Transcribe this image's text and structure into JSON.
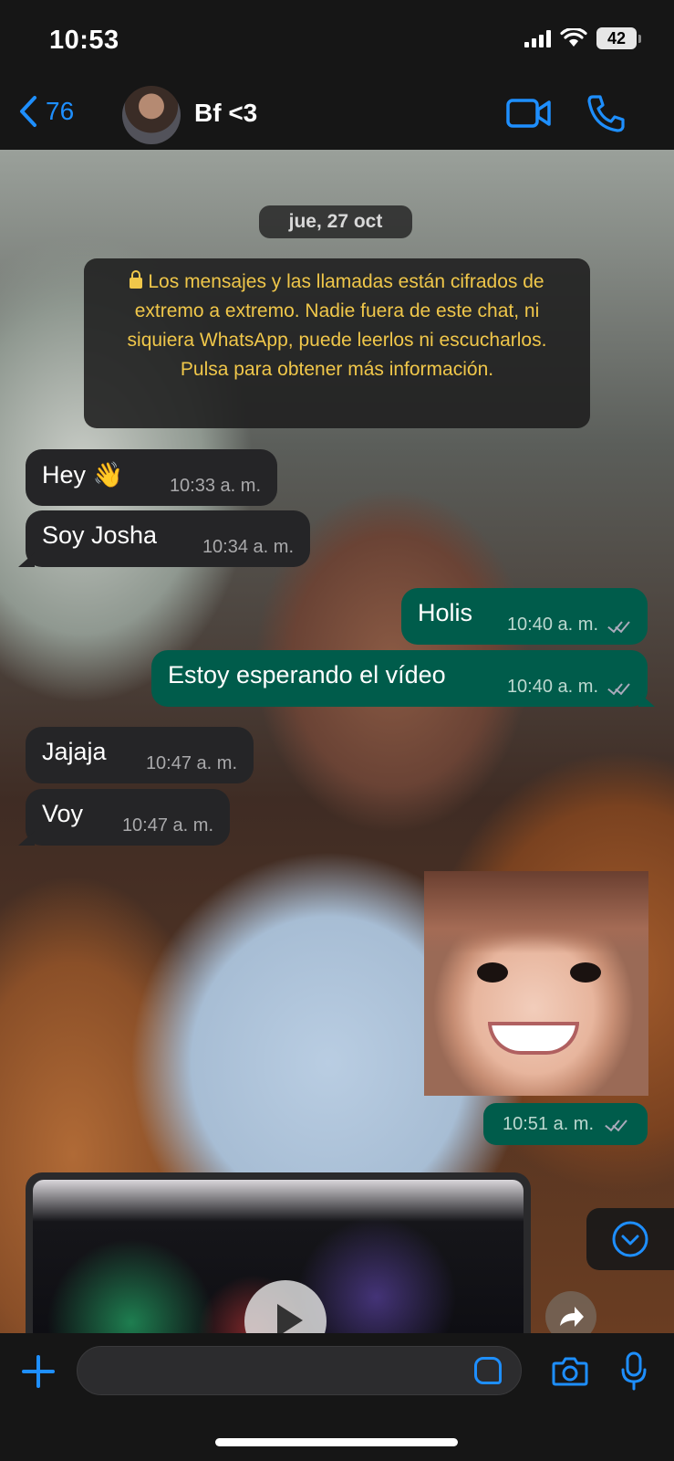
{
  "status_bar": {
    "time": "10:53",
    "battery": "42"
  },
  "header": {
    "back_count": "76",
    "contact_name": "Bf <3"
  },
  "chat": {
    "date_label": "jue, 27 oct",
    "encryption_notice": "Los mensajes y las llamadas están cifrados de extremo a extremo. Nadie fuera de este chat, ni siquiera WhatsApp, puede leerlos ni escucharlos. Pulsa para obtener más información.",
    "messages": [
      {
        "text": "Hey 👋",
        "time": "10:33 a. m.",
        "direction": "incoming"
      },
      {
        "text": "Soy Josha",
        "time": "10:34 a. m.",
        "direction": "incoming"
      },
      {
        "text": "Holis",
        "time": "10:40 a. m.",
        "direction": "outgoing",
        "status": "read"
      },
      {
        "text": "Estoy esperando el vídeo",
        "time": "10:40 a. m.",
        "direction": "outgoing",
        "status": "read"
      },
      {
        "text": "Jajaja",
        "time": "10:47 a. m.",
        "direction": "incoming"
      },
      {
        "text": "Voy",
        "time": "10:47 a. m.",
        "direction": "incoming"
      }
    ],
    "photo_message": {
      "time": "10:51 a. m.",
      "direction": "outgoing",
      "status": "read"
    },
    "video_message": {
      "direction": "incoming",
      "icon": "play-icon"
    }
  },
  "composer": {
    "placeholder": ""
  },
  "colors": {
    "accent": "#1e8fff",
    "outgoing": "#005c4b",
    "incoming": "#252527",
    "notice": "#f0c74a"
  }
}
